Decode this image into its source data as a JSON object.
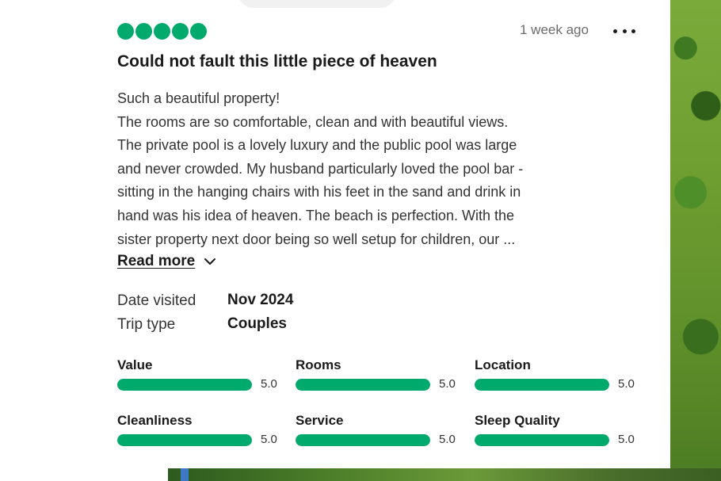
{
  "review": {
    "rating": 5,
    "max_rating": 5,
    "time_ago": "1 week ago",
    "title": "Could not fault this little piece of heaven",
    "body_lines": [
      "Such a beautiful property!",
      "The rooms are so comfortable, clean and with beautiful views.",
      "The private pool is a lovely luxury and the public pool was large",
      "and never crowded.  My husband particularly loved the pool bar -",
      "sitting in the hanging chairs with his feet in the sand and drink in",
      "hand was his idea of heaven.  The beach is perfection.  With the",
      "sister property next door being so well setup for children, our ..."
    ],
    "read_more_label": "Read more",
    "more_icon": "more-horizontal-icon",
    "chevron_icon": "chevron-down-icon"
  },
  "details": {
    "date_visited_label": "Date visited",
    "date_visited_value": "Nov 2024",
    "trip_type_label": "Trip type",
    "trip_type_value": "Couples"
  },
  "sub_ratings": [
    {
      "label": "Value",
      "score": "5.0",
      "fraction": 1.0
    },
    {
      "label": "Rooms",
      "score": "5.0",
      "fraction": 1.0
    },
    {
      "label": "Location",
      "score": "5.0",
      "fraction": 1.0
    },
    {
      "label": "Cleanliness",
      "score": "5.0",
      "fraction": 1.0
    },
    {
      "label": "Service",
      "score": "5.0",
      "fraction": 1.0
    },
    {
      "label": "Sleep Quality",
      "score": "5.0",
      "fraction": 1.0
    }
  ],
  "colors": {
    "accent_green": "#00aa6c",
    "text_dark": "#1a1a1a",
    "text_body": "#333333",
    "text_muted": "#6b6b6b"
  }
}
